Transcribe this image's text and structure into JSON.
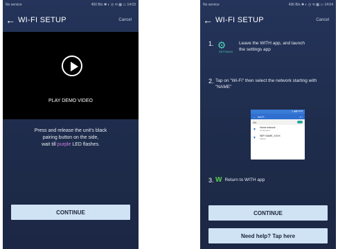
{
  "left": {
    "status": {
      "carrier": "No service",
      "info": "450 B/s ✱ ◐ ◷ ⟲ ▦ ▭ 14:03"
    },
    "title": "WI-FI SETUP",
    "cancel": "Cancel",
    "video_label": "PLAY DEMO VIDEO",
    "instruction_1": "Press and release the unit's black",
    "instruction_2": "pairing button on the side,",
    "instruction_3a": "wait till ",
    "instruction_3b": "purple",
    "instruction_3c": " LED flashes.",
    "continue": "CONTINUE"
  },
  "right": {
    "status": {
      "carrier": "No service",
      "info": "436 B/s ✱ ◐ ◷ ⟲ ▦ ▭ 14:04"
    },
    "title": "WI-FI SETUP",
    "cancel": "Cancel",
    "step1_num": "1.",
    "settings_label": "SETTINGS",
    "step1_text": "Leave the WITH app, and launch the settings app",
    "step2_num": "2.",
    "step2_text": "Tap on \"Wi-Fi\" then select the network starting with \"NAME\"",
    "card": {
      "status": "▽ ◢ ▮ 14:04",
      "wifi_title": "Wi-Fi",
      "on_label": "On",
      "net1": "Home network",
      "net1_sub": "Connected",
      "net2": "WIFI NAME_XXXX",
      "net2_sub": "Saved"
    },
    "step3_num": "3.",
    "step3_text": "Return to WITH app",
    "continue": "CONTINUE",
    "help": "Need help? Tap here"
  }
}
